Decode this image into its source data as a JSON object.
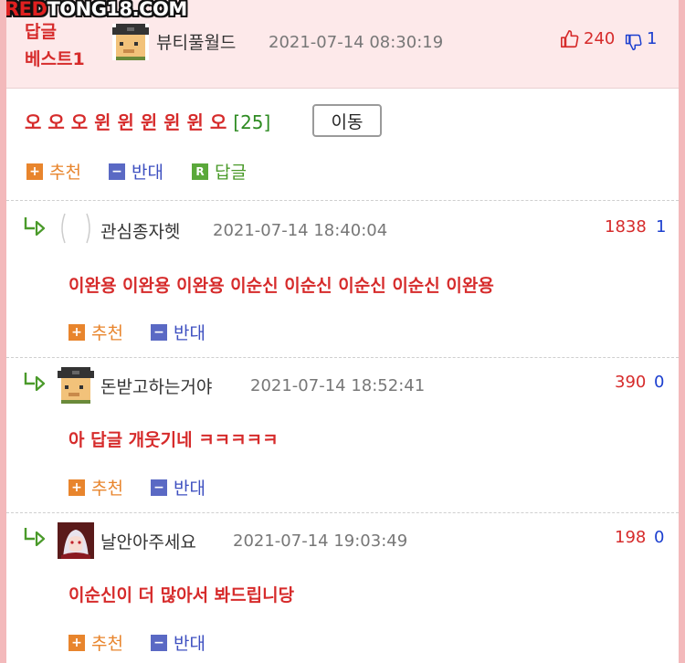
{
  "watermark": {
    "part1": "RED",
    "part2": "TONG18.COM"
  },
  "post": {
    "best_badge_line1": "답글",
    "best_badge_line2": "베스트1",
    "author": "뷰티풀월드",
    "date": "2021-07-14 08:30:19",
    "up_count": "240",
    "down_count": "1",
    "title": "오 오 오 윈 윈 윈 윈 윈 오",
    "comment_count": "[25]",
    "move_label": "이동",
    "actions": {
      "recommend": "추천",
      "oppose": "반대",
      "reply": "답글"
    }
  },
  "icons": {
    "up": "thumbs-up-icon",
    "down": "thumbs-down-icon",
    "reply": "reply-arrow-icon",
    "plus": "plus-icon",
    "minus": "minus-icon",
    "r_badge": "R"
  },
  "colors": {
    "accent_red": "#d62b2b",
    "blue": "#1c3fcf",
    "orange": "#e8852d",
    "green": "#4a9a2a",
    "frame": "#f3b9bb"
  },
  "comments": [
    {
      "author": "관심종자헷",
      "date": "2021-07-14 18:40:04",
      "up": "1838",
      "down": "1",
      "text": "이완용 이완용 이완용 이순신 이순신 이순신 이순신 이완용",
      "recommend": "추천",
      "oppose": "반대"
    },
    {
      "author": "돈받고하는거야",
      "date": "2021-07-14 18:52:41",
      "up": "390",
      "down": "0",
      "text": "아 답글 개웃기네 ㅋㅋㅋㅋㅋ",
      "recommend": "추천",
      "oppose": "반대"
    },
    {
      "author": "날안아주세요",
      "date": "2021-07-14 19:03:49",
      "up": "198",
      "down": "0",
      "text": "이순신이 더 많아서 봐드립니당",
      "recommend": "추천",
      "oppose": "반대"
    }
  ]
}
